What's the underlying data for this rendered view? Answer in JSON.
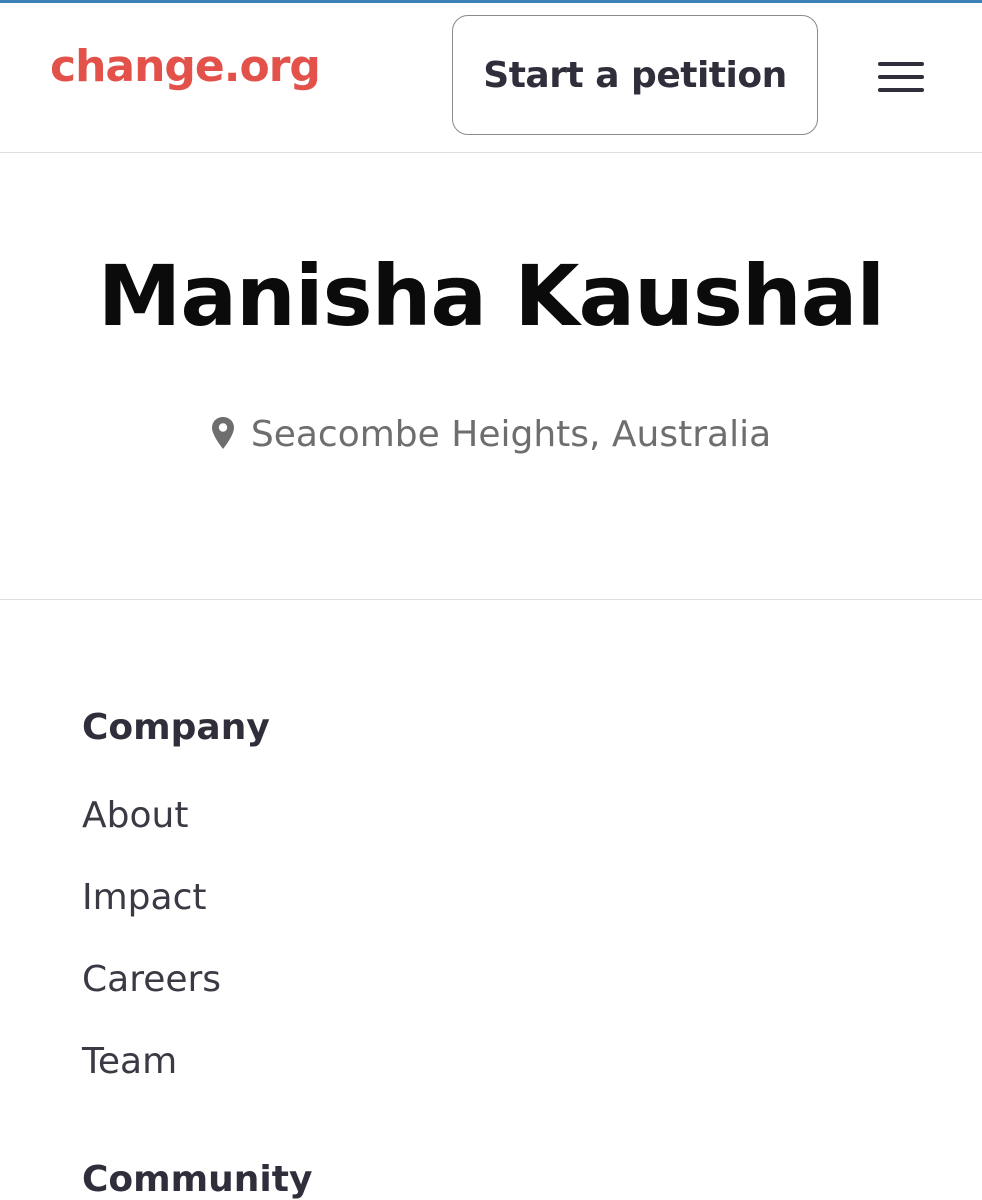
{
  "header": {
    "logo_text": "change.org",
    "start_petition_label": "Start a petition",
    "menu_icon": "hamburger-menu-icon"
  },
  "profile": {
    "name": "Manisha Kaushal",
    "location": "Seacombe Heights, Australia",
    "location_icon": "map-pin-icon"
  },
  "footer": {
    "company": {
      "heading": "Company",
      "links": [
        "About",
        "Impact",
        "Careers",
        "Team"
      ]
    },
    "community": {
      "heading": "Community"
    }
  },
  "colors": {
    "brand": "#e2524a",
    "text_dark": "#2f2e3a",
    "text_muted": "#6e6e6e",
    "top_accent": "#3b82b8"
  }
}
